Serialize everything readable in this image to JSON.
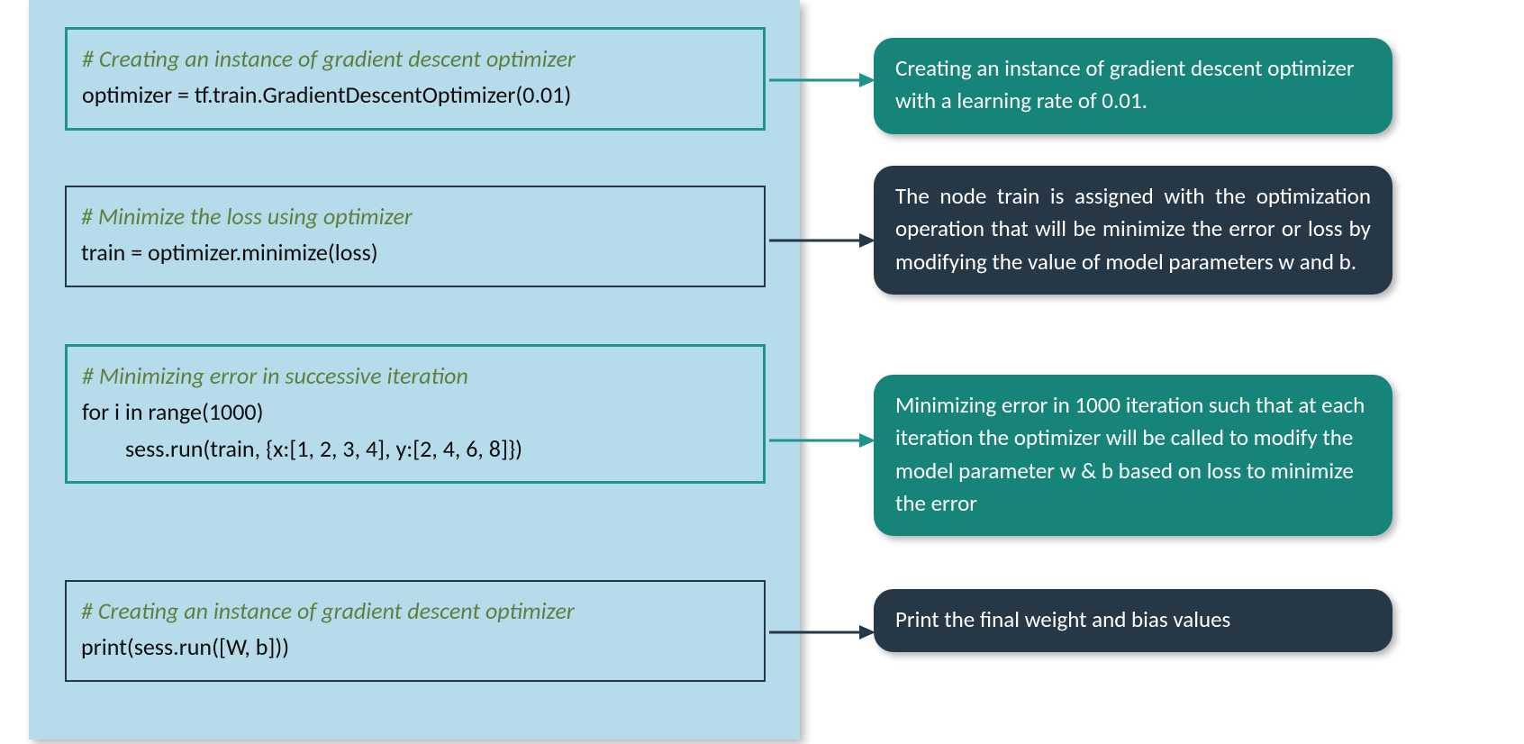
{
  "blocks": [
    {
      "comment": "# Creating an instance of gradient descent optimizer",
      "code": "optimizer = tf.train.GradientDescentOptimizer(0.01)"
    },
    {
      "comment": "# Minimize the loss using optimizer",
      "code": "train = optimizer.minimize(loss)"
    },
    {
      "comment": "# Minimizing error in successive iteration",
      "code_line1": "for i in range(1000)",
      "code_line2": "sess.run(train, {x:[1, 2, 3, 4], y:[2, 4, 6, 8]})"
    },
    {
      "comment": "# Creating an instance of gradient descent optimizer",
      "code": "print(sess.run([W, b]))"
    }
  ],
  "callouts": [
    "Creating an instance of gradient descent optimizer with a learning rate of 0.01.",
    "The node train is assigned with the optimization operation that will be minimize the error or loss by modifying the value of model parameters w and b.",
    "Minimizing error in 1000 iteration such that at each iteration the optimizer will be called to modify the model parameter w  & b based on loss to minimize the error",
    "Print the final weight and bias values"
  ]
}
